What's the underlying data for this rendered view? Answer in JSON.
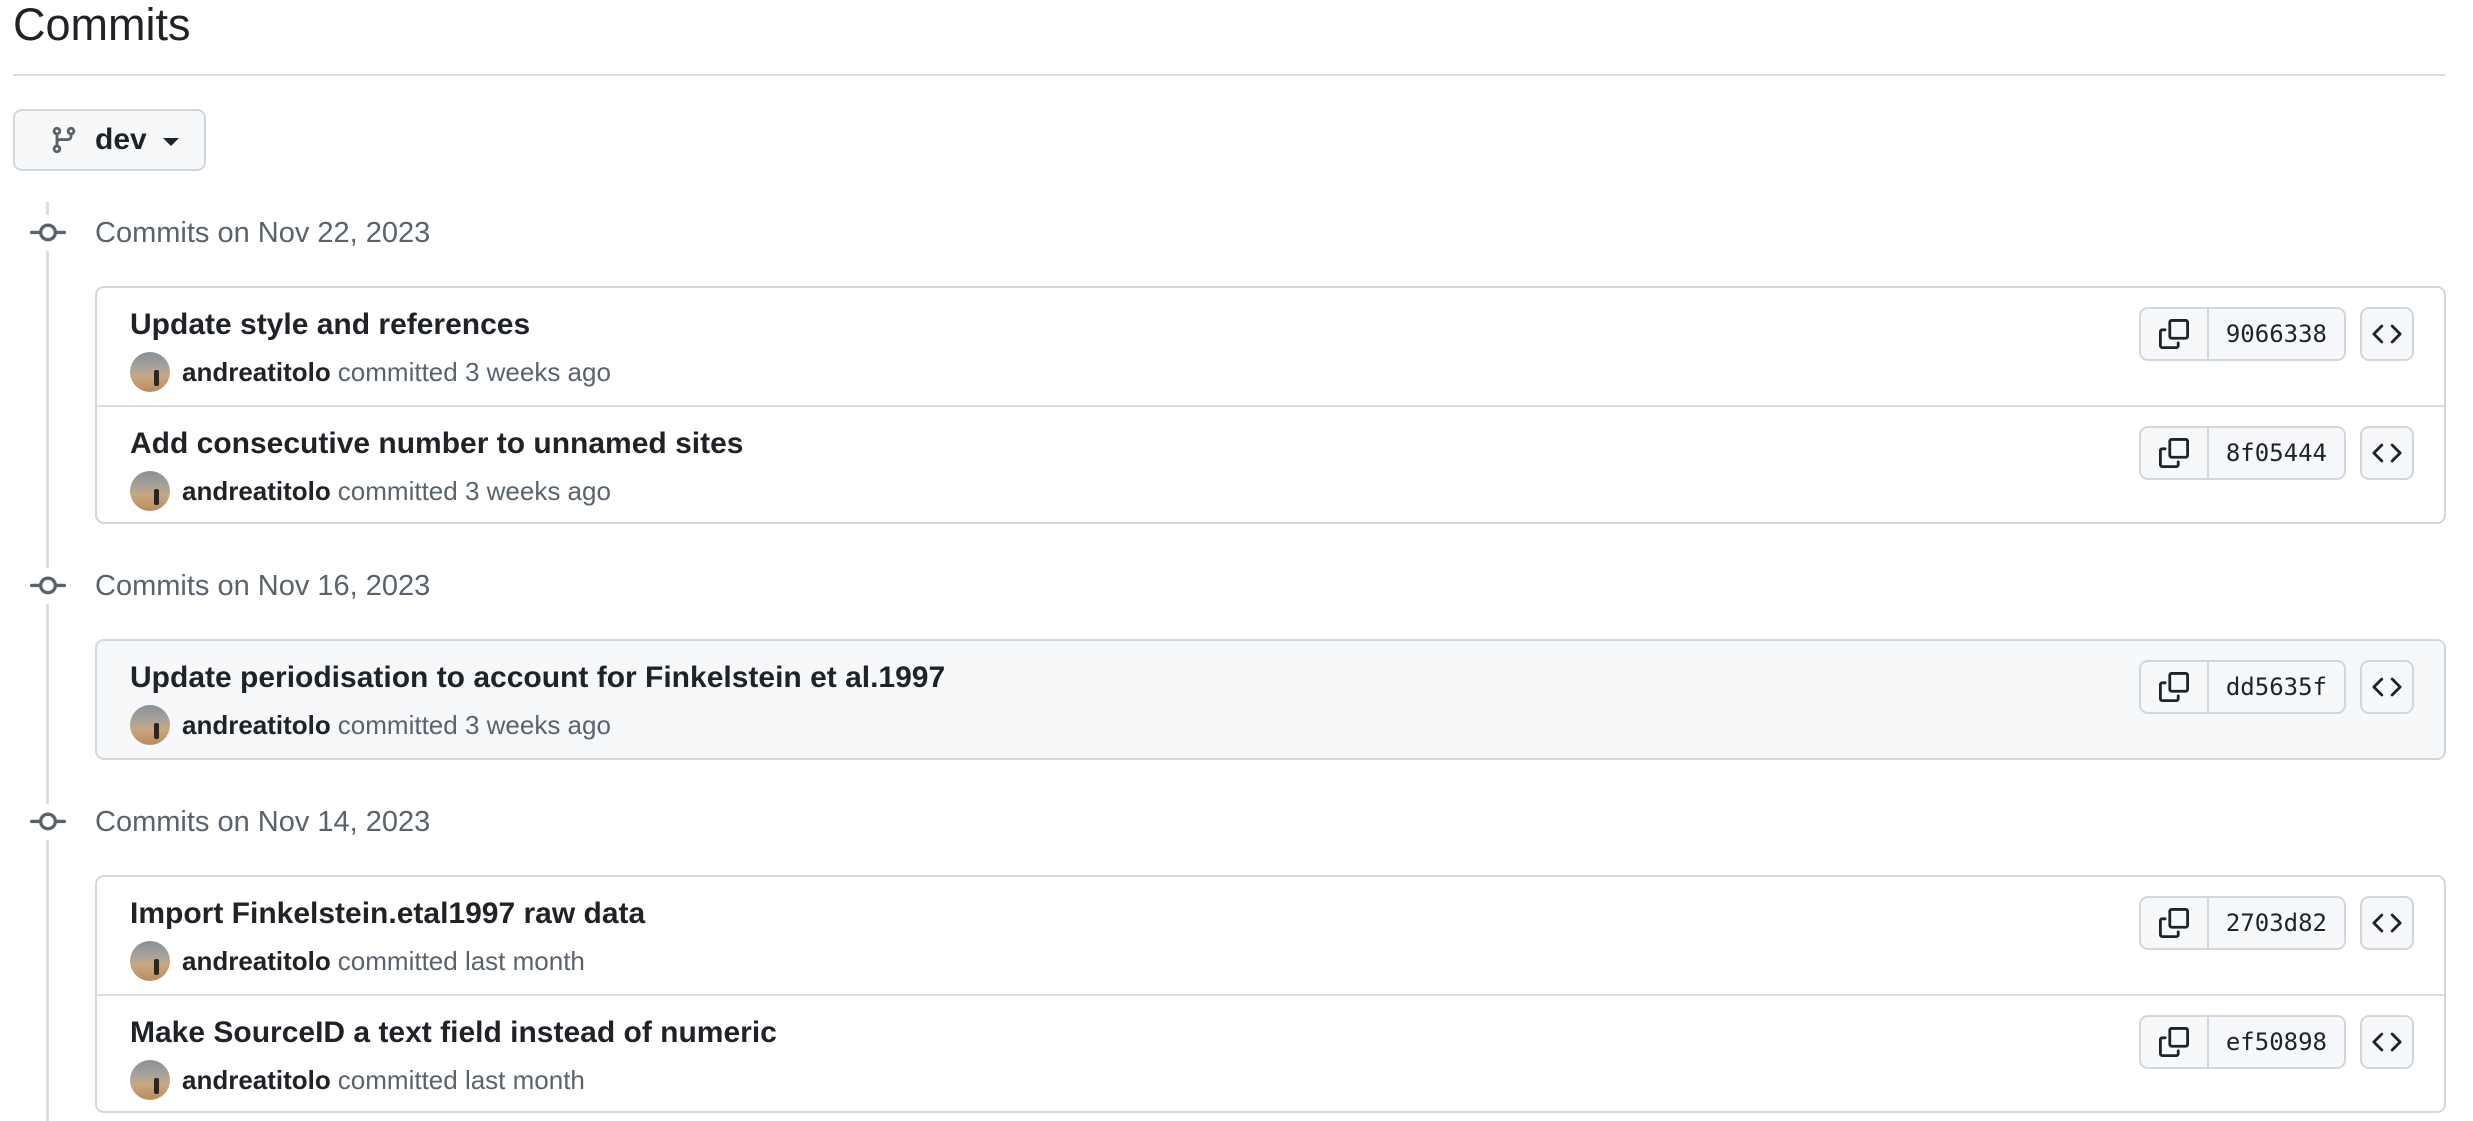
{
  "page": {
    "title": "Commits"
  },
  "branch": {
    "name": "dev",
    "icon": "git-branch-icon"
  },
  "groups": [
    {
      "title": "Commits on Nov 22, 2023",
      "commits": [
        {
          "message": "Update style and references",
          "author": "andreatitolo",
          "when": "committed 3 weeks ago",
          "sha": "9066338"
        },
        {
          "message": "Add consecutive number to unnamed sites",
          "author": "andreatitolo",
          "when": "committed 3 weeks ago",
          "sha": "8f05444"
        }
      ]
    },
    {
      "title": "Commits on Nov 16, 2023",
      "commits": [
        {
          "message": "Update periodisation to account for Finkelstein et al.1997",
          "author": "andreatitolo",
          "when": "committed 3 weeks ago",
          "sha": "dd5635f"
        }
      ]
    },
    {
      "title": "Commits on Nov 14, 2023",
      "commits": [
        {
          "message": "Import Finkelstein.etal1997 raw data",
          "author": "andreatitolo",
          "when": "committed last month",
          "sha": "2703d82"
        },
        {
          "message": "Make SourceID a text field instead of numeric",
          "author": "andreatitolo",
          "when": "committed last month",
          "sha": "ef50898"
        }
      ]
    }
  ],
  "icons": {
    "copy": "copy-icon",
    "browse": "code-icon",
    "node": "git-commit-icon"
  },
  "colors": {
    "border": "#d0d7de",
    "muted_text": "#59636e",
    "text": "#1f2328",
    "button_bg": "#f6f8fa"
  }
}
